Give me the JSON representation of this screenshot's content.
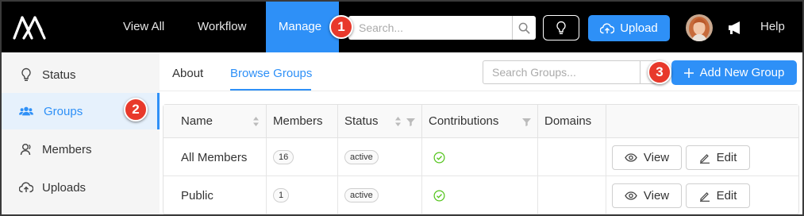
{
  "topbar": {
    "nav": [
      "View All",
      "Workflow",
      "Manage"
    ],
    "active_nav": "Manage",
    "search_placeholder": "Search...",
    "upload_label": "Upload",
    "help_label": "Help",
    "accent": "#2e90f7"
  },
  "sidebar": {
    "items": [
      {
        "label": "Status",
        "icon": "lightbulb-icon"
      },
      {
        "label": "Groups",
        "icon": "users-icon",
        "active": true
      },
      {
        "label": "Members",
        "icon": "user-icon"
      },
      {
        "label": "Uploads",
        "icon": "cloud-upload-icon"
      }
    ]
  },
  "main": {
    "tabs": [
      {
        "label": "About"
      },
      {
        "label": "Browse Groups",
        "active": true
      }
    ],
    "group_search_placeholder": "Search Groups...",
    "add_group_label": "Add New Group"
  },
  "table": {
    "columns": [
      "Name",
      "Members",
      "Status",
      "Contributions",
      "Domains"
    ],
    "rows": [
      {
        "name": "All Members",
        "members": "16",
        "status": "active",
        "view": "View",
        "edit": "Edit"
      },
      {
        "name": "Public",
        "members": "1",
        "status": "active",
        "view": "View",
        "edit": "Edit"
      }
    ]
  },
  "callouts": [
    "1",
    "2",
    "3"
  ],
  "colors": {
    "brand_blue": "#2e90f7",
    "callout_red": "#e8392b",
    "status_ok": "#52c41a"
  }
}
